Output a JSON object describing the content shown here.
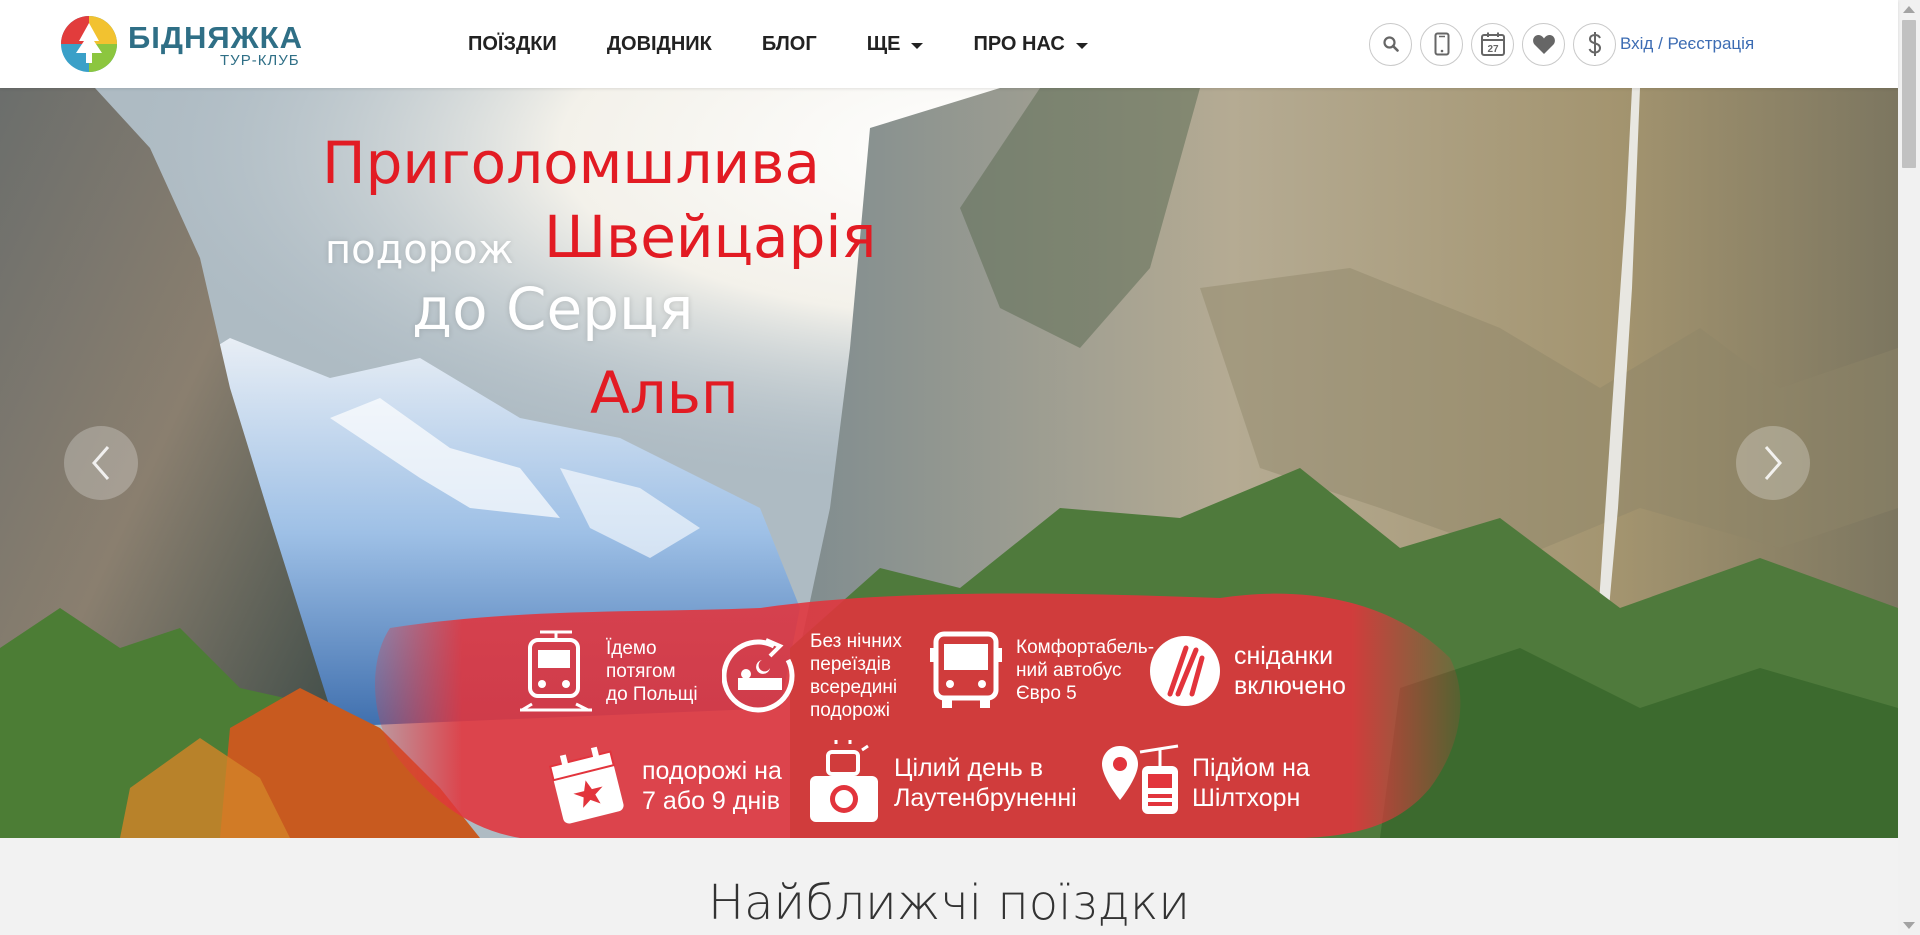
{
  "brand": {
    "name": "БІДНЯЖКА",
    "subtitle": "ТУР-КЛУБ"
  },
  "nav": {
    "items": [
      {
        "label": "ПОЇЗДКИ"
      },
      {
        "label": "ДОВІДНИК"
      },
      {
        "label": "БЛОГ"
      },
      {
        "label": "ЩЕ"
      },
      {
        "label": "ПРО НАС"
      }
    ]
  },
  "tools": {
    "calendar_day": "27",
    "login_label": "Вхід / Реєстрація"
  },
  "hero": {
    "line1": "Приголомшлива",
    "line2a": "подорож",
    "line2b": "Швейцарія",
    "line3": "до Серця",
    "line4": "Альп",
    "features": [
      {
        "icon": "train-icon",
        "text": "Їдемо\nпотягом\nдо Польщі"
      },
      {
        "icon": "night-bed-icon",
        "text": "Без нічних\nпереїздів\nвсередині\nподорожі"
      },
      {
        "icon": "bus-icon",
        "text": "Комфортабель-\nний автобус\nЄвро 5"
      },
      {
        "icon": "cutlery-icon",
        "text": "сніданки\nвключено"
      },
      {
        "icon": "calendar-star-icon",
        "text": "подорожі на\n7 або 9 днів"
      },
      {
        "icon": "camera-icon",
        "text": "Цілий день в\nЛаутенбруненні"
      },
      {
        "icon": "cable-car-icon",
        "text": "Підйом на\nШілтхорн"
      }
    ]
  },
  "section": {
    "title": "Найближчі поїздки"
  },
  "colors": {
    "accent_red": "#e21b23",
    "brand_teal": "#2f6f86",
    "link_blue": "#3c6cb3"
  }
}
